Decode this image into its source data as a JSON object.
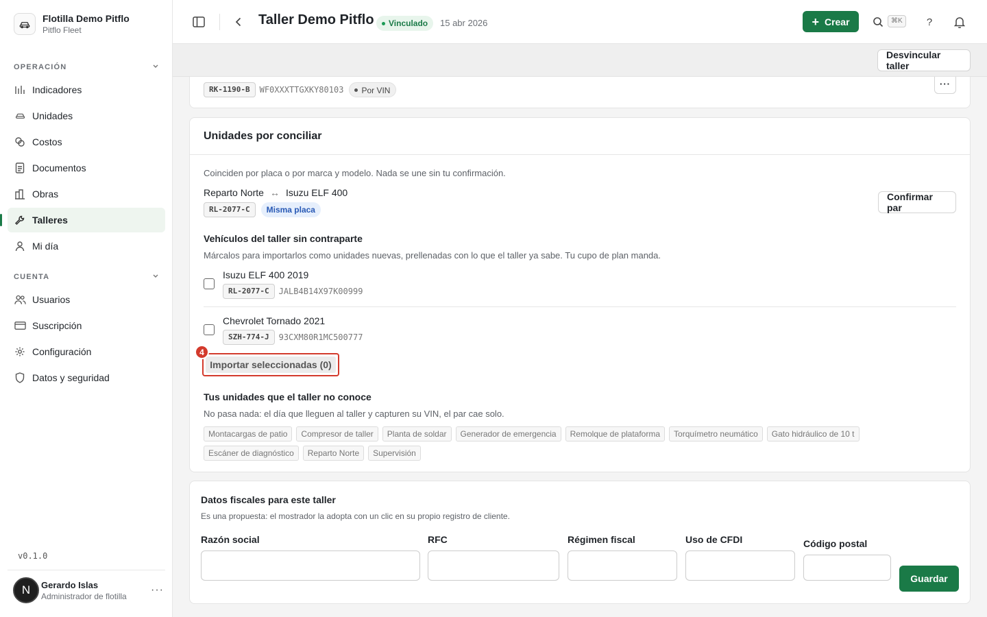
{
  "org": {
    "name": "Flotilla Demo Pitflo",
    "sub": "Pitflo Fleet"
  },
  "sidebar": {
    "section_operacion": "OPERACIÓN",
    "section_cuenta": "CUENTA",
    "items_operacion": [
      {
        "label": "Indicadores",
        "icon": "chart-icon"
      },
      {
        "label": "Unidades",
        "icon": "car-icon"
      },
      {
        "label": "Costos",
        "icon": "coins-icon"
      },
      {
        "label": "Documentos",
        "icon": "document-icon"
      },
      {
        "label": "Obras",
        "icon": "building-icon"
      },
      {
        "label": "Talleres",
        "icon": "wrench-icon",
        "active": true
      },
      {
        "label": "Mi día",
        "icon": "user-icon"
      }
    ],
    "items_cuenta": [
      {
        "label": "Usuarios",
        "icon": "users-icon"
      },
      {
        "label": "Suscripción",
        "icon": "card-icon"
      },
      {
        "label": "Configuración",
        "icon": "gear-icon"
      },
      {
        "label": "Datos y seguridad",
        "icon": "shield-icon"
      }
    ],
    "version": "v0.1.0",
    "user": {
      "initial": "N",
      "name": "Gerardo Islas",
      "role": "Administrador de flotilla",
      "more": "···"
    }
  },
  "header": {
    "title": "Taller Demo Pitflo",
    "status": "Vinculado",
    "date": "15 abr 2026",
    "create_label": "Crear",
    "shortcut": "⌘K",
    "help": "?"
  },
  "subheader": {
    "unlink_label": "Desvincular taller"
  },
  "linked_vehicle": {
    "plate": "RK-1190-B",
    "vin": "WF0XXXTTGXKY80103",
    "chip": "Por VIN",
    "more": "···"
  },
  "reconcile": {
    "title": "Unidades por conciliar",
    "intro": "Coinciden por placa o por marca y modelo. Nada se une sin tu confirmación.",
    "pair": {
      "left": "Reparto Norte",
      "arrow": "↔",
      "right": "Isuzu ELF 400",
      "plate": "RL-2077-C",
      "chip": "Misma placa",
      "confirm_label": "Confirmar par"
    },
    "workshop_heading": "Vehículos del taller sin contraparte",
    "workshop_desc": "Márcalos para importarlos como unidades nuevas, prellenadas con lo que el taller ya sabe. Tu cupo de plan manda.",
    "vehicles": [
      {
        "name": "Isuzu ELF 400 2019",
        "plate": "RL-2077-C",
        "vin": "JALB4B14X97K00999"
      },
      {
        "name": "Chevrolet Tornado 2021",
        "plate": "SZH-774-J",
        "vin": "93CXM80R1MC500777"
      }
    ],
    "import_label": "Importar seleccionadas (0)",
    "marker": "4",
    "unknown_heading": "Tus unidades que el taller no conoce",
    "unknown_desc": "No pasa nada: el día que lleguen al taller y capturen su VIN, el par cae solo.",
    "tags": [
      "Montacargas de patio",
      "Compresor de taller",
      "Planta de soldar",
      "Generador de emergencia",
      "Remolque de plataforma",
      "Torquímetro neumático",
      "Gato hidráulico de 10 t",
      "Escáner de diagnóstico",
      "Reparto Norte",
      "Supervisión"
    ]
  },
  "fiscal": {
    "title": "Datos fiscales para este taller",
    "desc": "Es una propuesta: el mostrador la adopta con un clic en su propio registro de cliente.",
    "fields": {
      "razon": "Razón social",
      "rfc": "RFC",
      "regimen": "Régimen fiscal",
      "cfdi": "Uso de CFDI",
      "cp": "Código postal"
    },
    "save_label": "Guardar"
  }
}
